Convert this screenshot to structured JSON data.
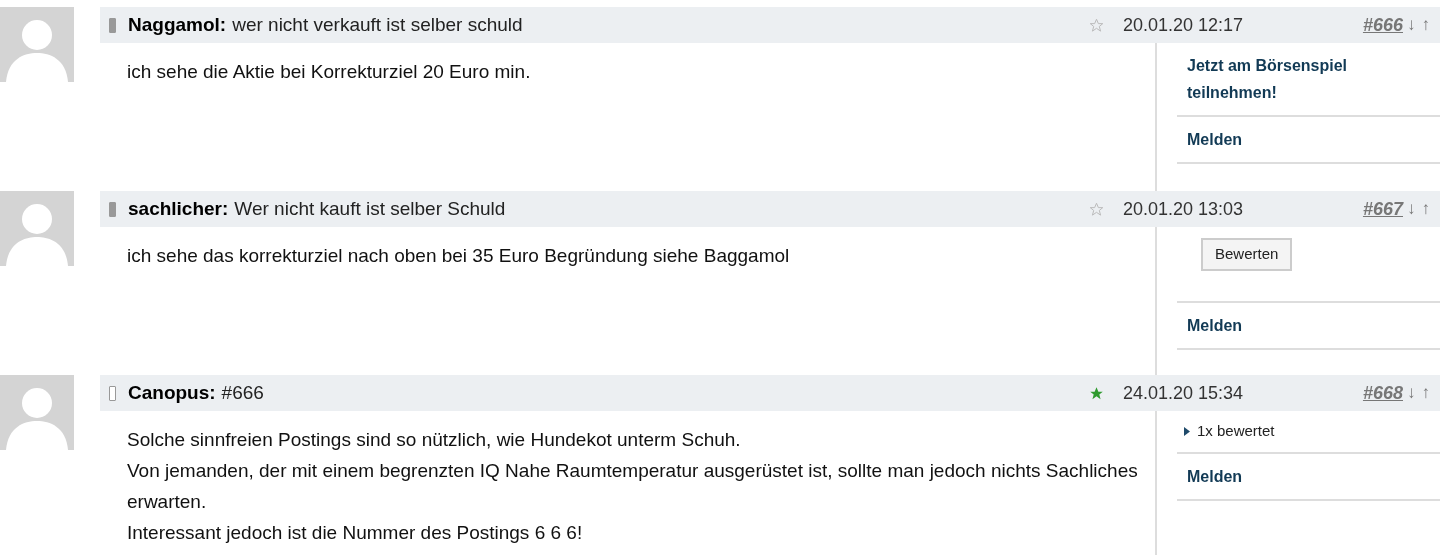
{
  "posts": [
    {
      "author": "Naggamol:",
      "title": "wer nicht verkauft ist selber schuld",
      "device_filled": true,
      "starred": false,
      "date": "20.01.20 12:17",
      "number": "#666",
      "down": "↓",
      "up": "↑",
      "body": [
        "ich sehe die Aktie bei Korrekturziel 20 Euro min."
      ],
      "actions": [
        {
          "kind": "link",
          "label": "Jetzt am Börsenspiel teilnehmen!"
        },
        {
          "kind": "link",
          "label": "Melden"
        }
      ]
    },
    {
      "author": "sachlicher:",
      "title": "Wer nicht kauft ist selber Schuld",
      "device_filled": true,
      "starred": false,
      "date": "20.01.20 13:03",
      "number": "#667",
      "down": "↓",
      "up": "↑",
      "body": [
        "ich sehe das korrekturziel nach oben bei 35 Euro Begründung siehe Baggamol"
      ],
      "actions": [
        {
          "kind": "button",
          "label": "Bewerten"
        },
        {
          "kind": "link",
          "label": "Melden"
        }
      ]
    },
    {
      "author": "Canopus:",
      "title": "#666",
      "device_filled": false,
      "starred": true,
      "date": "24.01.20 15:34",
      "number": "#668",
      "down": "↓",
      "up": "↑",
      "body": [
        "Solche sinnfreien Postings sind so nützlich, wie Hundekot unterm Schuh.",
        "Von jemanden, der mit einem begrenzten IQ Nahe Raumtemperatur ausgerüstet ist, sollte man jedoch nichts Sachliches erwarten.",
        "Interessant jedoch ist die Nummer des Postings 6 6 6!"
      ],
      "actions": [
        {
          "kind": "toggle",
          "label": "1x bewertet",
          "expanded": false
        },
        {
          "kind": "link",
          "label": "Melden"
        }
      ]
    }
  ]
}
